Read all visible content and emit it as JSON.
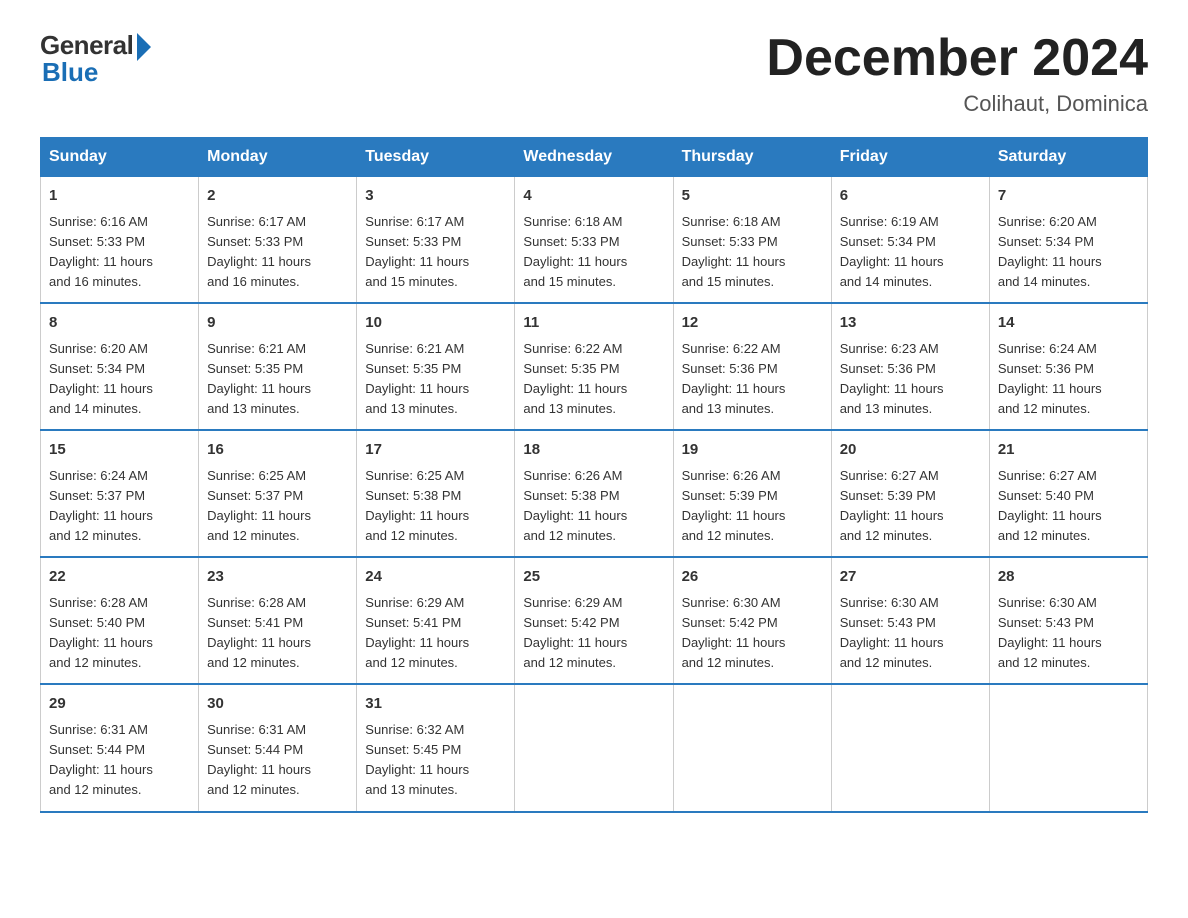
{
  "logo": {
    "general": "General",
    "blue": "Blue"
  },
  "title": "December 2024",
  "location": "Colihaut, Dominica",
  "days_header": [
    "Sunday",
    "Monday",
    "Tuesday",
    "Wednesday",
    "Thursday",
    "Friday",
    "Saturday"
  ],
  "weeks": [
    [
      {
        "day": "1",
        "sunrise": "6:16 AM",
        "sunset": "5:33 PM",
        "daylight": "11 hours and 16 minutes."
      },
      {
        "day": "2",
        "sunrise": "6:17 AM",
        "sunset": "5:33 PM",
        "daylight": "11 hours and 16 minutes."
      },
      {
        "day": "3",
        "sunrise": "6:17 AM",
        "sunset": "5:33 PM",
        "daylight": "11 hours and 15 minutes."
      },
      {
        "day": "4",
        "sunrise": "6:18 AM",
        "sunset": "5:33 PM",
        "daylight": "11 hours and 15 minutes."
      },
      {
        "day": "5",
        "sunrise": "6:18 AM",
        "sunset": "5:33 PM",
        "daylight": "11 hours and 15 minutes."
      },
      {
        "day": "6",
        "sunrise": "6:19 AM",
        "sunset": "5:34 PM",
        "daylight": "11 hours and 14 minutes."
      },
      {
        "day": "7",
        "sunrise": "6:20 AM",
        "sunset": "5:34 PM",
        "daylight": "11 hours and 14 minutes."
      }
    ],
    [
      {
        "day": "8",
        "sunrise": "6:20 AM",
        "sunset": "5:34 PM",
        "daylight": "11 hours and 14 minutes."
      },
      {
        "day": "9",
        "sunrise": "6:21 AM",
        "sunset": "5:35 PM",
        "daylight": "11 hours and 13 minutes."
      },
      {
        "day": "10",
        "sunrise": "6:21 AM",
        "sunset": "5:35 PM",
        "daylight": "11 hours and 13 minutes."
      },
      {
        "day": "11",
        "sunrise": "6:22 AM",
        "sunset": "5:35 PM",
        "daylight": "11 hours and 13 minutes."
      },
      {
        "day": "12",
        "sunrise": "6:22 AM",
        "sunset": "5:36 PM",
        "daylight": "11 hours and 13 minutes."
      },
      {
        "day": "13",
        "sunrise": "6:23 AM",
        "sunset": "5:36 PM",
        "daylight": "11 hours and 13 minutes."
      },
      {
        "day": "14",
        "sunrise": "6:24 AM",
        "sunset": "5:36 PM",
        "daylight": "11 hours and 12 minutes."
      }
    ],
    [
      {
        "day": "15",
        "sunrise": "6:24 AM",
        "sunset": "5:37 PM",
        "daylight": "11 hours and 12 minutes."
      },
      {
        "day": "16",
        "sunrise": "6:25 AM",
        "sunset": "5:37 PM",
        "daylight": "11 hours and 12 minutes."
      },
      {
        "day": "17",
        "sunrise": "6:25 AM",
        "sunset": "5:38 PM",
        "daylight": "11 hours and 12 minutes."
      },
      {
        "day": "18",
        "sunrise": "6:26 AM",
        "sunset": "5:38 PM",
        "daylight": "11 hours and 12 minutes."
      },
      {
        "day": "19",
        "sunrise": "6:26 AM",
        "sunset": "5:39 PM",
        "daylight": "11 hours and 12 minutes."
      },
      {
        "day": "20",
        "sunrise": "6:27 AM",
        "sunset": "5:39 PM",
        "daylight": "11 hours and 12 minutes."
      },
      {
        "day": "21",
        "sunrise": "6:27 AM",
        "sunset": "5:40 PM",
        "daylight": "11 hours and 12 minutes."
      }
    ],
    [
      {
        "day": "22",
        "sunrise": "6:28 AM",
        "sunset": "5:40 PM",
        "daylight": "11 hours and 12 minutes."
      },
      {
        "day": "23",
        "sunrise": "6:28 AM",
        "sunset": "5:41 PM",
        "daylight": "11 hours and 12 minutes."
      },
      {
        "day": "24",
        "sunrise": "6:29 AM",
        "sunset": "5:41 PM",
        "daylight": "11 hours and 12 minutes."
      },
      {
        "day": "25",
        "sunrise": "6:29 AM",
        "sunset": "5:42 PM",
        "daylight": "11 hours and 12 minutes."
      },
      {
        "day": "26",
        "sunrise": "6:30 AM",
        "sunset": "5:42 PM",
        "daylight": "11 hours and 12 minutes."
      },
      {
        "day": "27",
        "sunrise": "6:30 AM",
        "sunset": "5:43 PM",
        "daylight": "11 hours and 12 minutes."
      },
      {
        "day": "28",
        "sunrise": "6:30 AM",
        "sunset": "5:43 PM",
        "daylight": "11 hours and 12 minutes."
      }
    ],
    [
      {
        "day": "29",
        "sunrise": "6:31 AM",
        "sunset": "5:44 PM",
        "daylight": "11 hours and 12 minutes."
      },
      {
        "day": "30",
        "sunrise": "6:31 AM",
        "sunset": "5:44 PM",
        "daylight": "11 hours and 12 minutes."
      },
      {
        "day": "31",
        "sunrise": "6:32 AM",
        "sunset": "5:45 PM",
        "daylight": "11 hours and 13 minutes."
      },
      null,
      null,
      null,
      null
    ]
  ],
  "labels": {
    "sunrise": "Sunrise:",
    "sunset": "Sunset:",
    "daylight": "Daylight:"
  }
}
